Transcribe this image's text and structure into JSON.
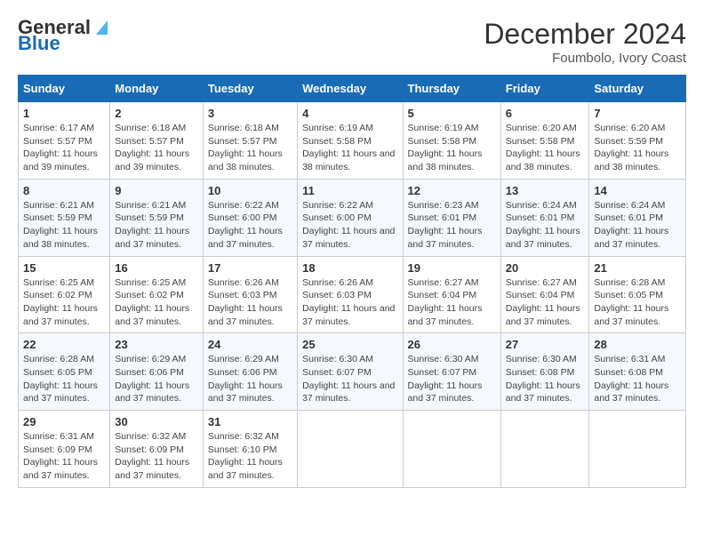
{
  "header": {
    "logo_text_general": "General",
    "logo_text_blue": "Blue",
    "main_title": "December 2024",
    "subtitle": "Foumbolo, Ivory Coast"
  },
  "calendar": {
    "days_of_week": [
      "Sunday",
      "Monday",
      "Tuesday",
      "Wednesday",
      "Thursday",
      "Friday",
      "Saturday"
    ],
    "weeks": [
      [
        {
          "day": "1",
          "sunrise": "6:17 AM",
          "sunset": "5:57 PM",
          "daylight": "11 hours and 39 minutes."
        },
        {
          "day": "2",
          "sunrise": "6:18 AM",
          "sunset": "5:57 PM",
          "daylight": "11 hours and 39 minutes."
        },
        {
          "day": "3",
          "sunrise": "6:18 AM",
          "sunset": "5:57 PM",
          "daylight": "11 hours and 38 minutes."
        },
        {
          "day": "4",
          "sunrise": "6:19 AM",
          "sunset": "5:58 PM",
          "daylight": "11 hours and 38 minutes."
        },
        {
          "day": "5",
          "sunrise": "6:19 AM",
          "sunset": "5:58 PM",
          "daylight": "11 hours and 38 minutes."
        },
        {
          "day": "6",
          "sunrise": "6:20 AM",
          "sunset": "5:58 PM",
          "daylight": "11 hours and 38 minutes."
        },
        {
          "day": "7",
          "sunrise": "6:20 AM",
          "sunset": "5:59 PM",
          "daylight": "11 hours and 38 minutes."
        }
      ],
      [
        {
          "day": "8",
          "sunrise": "6:21 AM",
          "sunset": "5:59 PM",
          "daylight": "11 hours and 38 minutes."
        },
        {
          "day": "9",
          "sunrise": "6:21 AM",
          "sunset": "5:59 PM",
          "daylight": "11 hours and 37 minutes."
        },
        {
          "day": "10",
          "sunrise": "6:22 AM",
          "sunset": "6:00 PM",
          "daylight": "11 hours and 37 minutes."
        },
        {
          "day": "11",
          "sunrise": "6:22 AM",
          "sunset": "6:00 PM",
          "daylight": "11 hours and 37 minutes."
        },
        {
          "day": "12",
          "sunrise": "6:23 AM",
          "sunset": "6:01 PM",
          "daylight": "11 hours and 37 minutes."
        },
        {
          "day": "13",
          "sunrise": "6:24 AM",
          "sunset": "6:01 PM",
          "daylight": "11 hours and 37 minutes."
        },
        {
          "day": "14",
          "sunrise": "6:24 AM",
          "sunset": "6:01 PM",
          "daylight": "11 hours and 37 minutes."
        }
      ],
      [
        {
          "day": "15",
          "sunrise": "6:25 AM",
          "sunset": "6:02 PM",
          "daylight": "11 hours and 37 minutes."
        },
        {
          "day": "16",
          "sunrise": "6:25 AM",
          "sunset": "6:02 PM",
          "daylight": "11 hours and 37 minutes."
        },
        {
          "day": "17",
          "sunrise": "6:26 AM",
          "sunset": "6:03 PM",
          "daylight": "11 hours and 37 minutes."
        },
        {
          "day": "18",
          "sunrise": "6:26 AM",
          "sunset": "6:03 PM",
          "daylight": "11 hours and 37 minutes."
        },
        {
          "day": "19",
          "sunrise": "6:27 AM",
          "sunset": "6:04 PM",
          "daylight": "11 hours and 37 minutes."
        },
        {
          "day": "20",
          "sunrise": "6:27 AM",
          "sunset": "6:04 PM",
          "daylight": "11 hours and 37 minutes."
        },
        {
          "day": "21",
          "sunrise": "6:28 AM",
          "sunset": "6:05 PM",
          "daylight": "11 hours and 37 minutes."
        }
      ],
      [
        {
          "day": "22",
          "sunrise": "6:28 AM",
          "sunset": "6:05 PM",
          "daylight": "11 hours and 37 minutes."
        },
        {
          "day": "23",
          "sunrise": "6:29 AM",
          "sunset": "6:06 PM",
          "daylight": "11 hours and 37 minutes."
        },
        {
          "day": "24",
          "sunrise": "6:29 AM",
          "sunset": "6:06 PM",
          "daylight": "11 hours and 37 minutes."
        },
        {
          "day": "25",
          "sunrise": "6:30 AM",
          "sunset": "6:07 PM",
          "daylight": "11 hours and 37 minutes."
        },
        {
          "day": "26",
          "sunrise": "6:30 AM",
          "sunset": "6:07 PM",
          "daylight": "11 hours and 37 minutes."
        },
        {
          "day": "27",
          "sunrise": "6:30 AM",
          "sunset": "6:08 PM",
          "daylight": "11 hours and 37 minutes."
        },
        {
          "day": "28",
          "sunrise": "6:31 AM",
          "sunset": "6:08 PM",
          "daylight": "11 hours and 37 minutes."
        }
      ],
      [
        {
          "day": "29",
          "sunrise": "6:31 AM",
          "sunset": "6:09 PM",
          "daylight": "11 hours and 37 minutes."
        },
        {
          "day": "30",
          "sunrise": "6:32 AM",
          "sunset": "6:09 PM",
          "daylight": "11 hours and 37 minutes."
        },
        {
          "day": "31",
          "sunrise": "6:32 AM",
          "sunset": "6:10 PM",
          "daylight": "11 hours and 37 minutes."
        },
        null,
        null,
        null,
        null
      ]
    ]
  }
}
